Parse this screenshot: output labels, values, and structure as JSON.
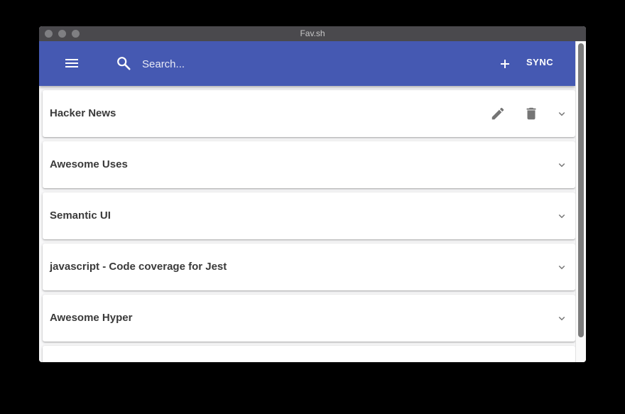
{
  "window": {
    "title": "Fav.sh"
  },
  "appbar": {
    "menu_icon": "hamburger-menu-icon",
    "search_icon": "search-icon",
    "search_placeholder": "Search...",
    "search_value": "",
    "add_icon": "plus-icon",
    "sync_label": "SYNC",
    "background_color": "#4559b2"
  },
  "bookmarks": [
    {
      "title": "Hacker News",
      "expanded_actions": true
    },
    {
      "title": "Awesome Uses"
    },
    {
      "title": "Semantic UI"
    },
    {
      "title": "javascript - Code coverage for Jest"
    },
    {
      "title": "Awesome Hyper"
    }
  ],
  "icons": {
    "edit": "pencil-icon",
    "delete": "trash-icon",
    "expand": "chevron-down-icon"
  }
}
